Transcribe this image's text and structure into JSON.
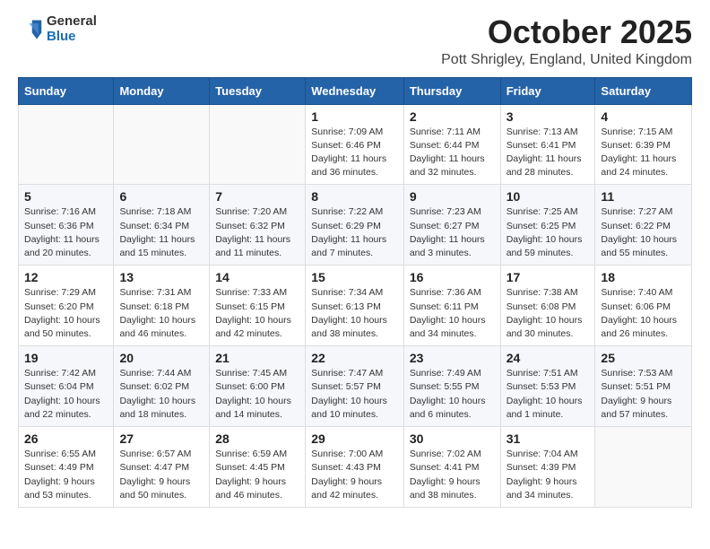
{
  "header": {
    "logo_line1": "General",
    "logo_line2": "Blue",
    "month_title": "October 2025",
    "location": "Pott Shrigley, England, United Kingdom"
  },
  "weekdays": [
    "Sunday",
    "Monday",
    "Tuesday",
    "Wednesday",
    "Thursday",
    "Friday",
    "Saturday"
  ],
  "weeks": [
    [
      {
        "day": "",
        "info": ""
      },
      {
        "day": "",
        "info": ""
      },
      {
        "day": "",
        "info": ""
      },
      {
        "day": "1",
        "info": "Sunrise: 7:09 AM\nSunset: 6:46 PM\nDaylight: 11 hours and 36 minutes."
      },
      {
        "day": "2",
        "info": "Sunrise: 7:11 AM\nSunset: 6:44 PM\nDaylight: 11 hours and 32 minutes."
      },
      {
        "day": "3",
        "info": "Sunrise: 7:13 AM\nSunset: 6:41 PM\nDaylight: 11 hours and 28 minutes."
      },
      {
        "day": "4",
        "info": "Sunrise: 7:15 AM\nSunset: 6:39 PM\nDaylight: 11 hours and 24 minutes."
      }
    ],
    [
      {
        "day": "5",
        "info": "Sunrise: 7:16 AM\nSunset: 6:36 PM\nDaylight: 11 hours and 20 minutes."
      },
      {
        "day": "6",
        "info": "Sunrise: 7:18 AM\nSunset: 6:34 PM\nDaylight: 11 hours and 15 minutes."
      },
      {
        "day": "7",
        "info": "Sunrise: 7:20 AM\nSunset: 6:32 PM\nDaylight: 11 hours and 11 minutes."
      },
      {
        "day": "8",
        "info": "Sunrise: 7:22 AM\nSunset: 6:29 PM\nDaylight: 11 hours and 7 minutes."
      },
      {
        "day": "9",
        "info": "Sunrise: 7:23 AM\nSunset: 6:27 PM\nDaylight: 11 hours and 3 minutes."
      },
      {
        "day": "10",
        "info": "Sunrise: 7:25 AM\nSunset: 6:25 PM\nDaylight: 10 hours and 59 minutes."
      },
      {
        "day": "11",
        "info": "Sunrise: 7:27 AM\nSunset: 6:22 PM\nDaylight: 10 hours and 55 minutes."
      }
    ],
    [
      {
        "day": "12",
        "info": "Sunrise: 7:29 AM\nSunset: 6:20 PM\nDaylight: 10 hours and 50 minutes."
      },
      {
        "day": "13",
        "info": "Sunrise: 7:31 AM\nSunset: 6:18 PM\nDaylight: 10 hours and 46 minutes."
      },
      {
        "day": "14",
        "info": "Sunrise: 7:33 AM\nSunset: 6:15 PM\nDaylight: 10 hours and 42 minutes."
      },
      {
        "day": "15",
        "info": "Sunrise: 7:34 AM\nSunset: 6:13 PM\nDaylight: 10 hours and 38 minutes."
      },
      {
        "day": "16",
        "info": "Sunrise: 7:36 AM\nSunset: 6:11 PM\nDaylight: 10 hours and 34 minutes."
      },
      {
        "day": "17",
        "info": "Sunrise: 7:38 AM\nSunset: 6:08 PM\nDaylight: 10 hours and 30 minutes."
      },
      {
        "day": "18",
        "info": "Sunrise: 7:40 AM\nSunset: 6:06 PM\nDaylight: 10 hours and 26 minutes."
      }
    ],
    [
      {
        "day": "19",
        "info": "Sunrise: 7:42 AM\nSunset: 6:04 PM\nDaylight: 10 hours and 22 minutes."
      },
      {
        "day": "20",
        "info": "Sunrise: 7:44 AM\nSunset: 6:02 PM\nDaylight: 10 hours and 18 minutes."
      },
      {
        "day": "21",
        "info": "Sunrise: 7:45 AM\nSunset: 6:00 PM\nDaylight: 10 hours and 14 minutes."
      },
      {
        "day": "22",
        "info": "Sunrise: 7:47 AM\nSunset: 5:57 PM\nDaylight: 10 hours and 10 minutes."
      },
      {
        "day": "23",
        "info": "Sunrise: 7:49 AM\nSunset: 5:55 PM\nDaylight: 10 hours and 6 minutes."
      },
      {
        "day": "24",
        "info": "Sunrise: 7:51 AM\nSunset: 5:53 PM\nDaylight: 10 hours and 1 minute."
      },
      {
        "day": "25",
        "info": "Sunrise: 7:53 AM\nSunset: 5:51 PM\nDaylight: 9 hours and 57 minutes."
      }
    ],
    [
      {
        "day": "26",
        "info": "Sunrise: 6:55 AM\nSunset: 4:49 PM\nDaylight: 9 hours and 53 minutes."
      },
      {
        "day": "27",
        "info": "Sunrise: 6:57 AM\nSunset: 4:47 PM\nDaylight: 9 hours and 50 minutes."
      },
      {
        "day": "28",
        "info": "Sunrise: 6:59 AM\nSunset: 4:45 PM\nDaylight: 9 hours and 46 minutes."
      },
      {
        "day": "29",
        "info": "Sunrise: 7:00 AM\nSunset: 4:43 PM\nDaylight: 9 hours and 42 minutes."
      },
      {
        "day": "30",
        "info": "Sunrise: 7:02 AM\nSunset: 4:41 PM\nDaylight: 9 hours and 38 minutes."
      },
      {
        "day": "31",
        "info": "Sunrise: 7:04 AM\nSunset: 4:39 PM\nDaylight: 9 hours and 34 minutes."
      },
      {
        "day": "",
        "info": ""
      }
    ]
  ]
}
